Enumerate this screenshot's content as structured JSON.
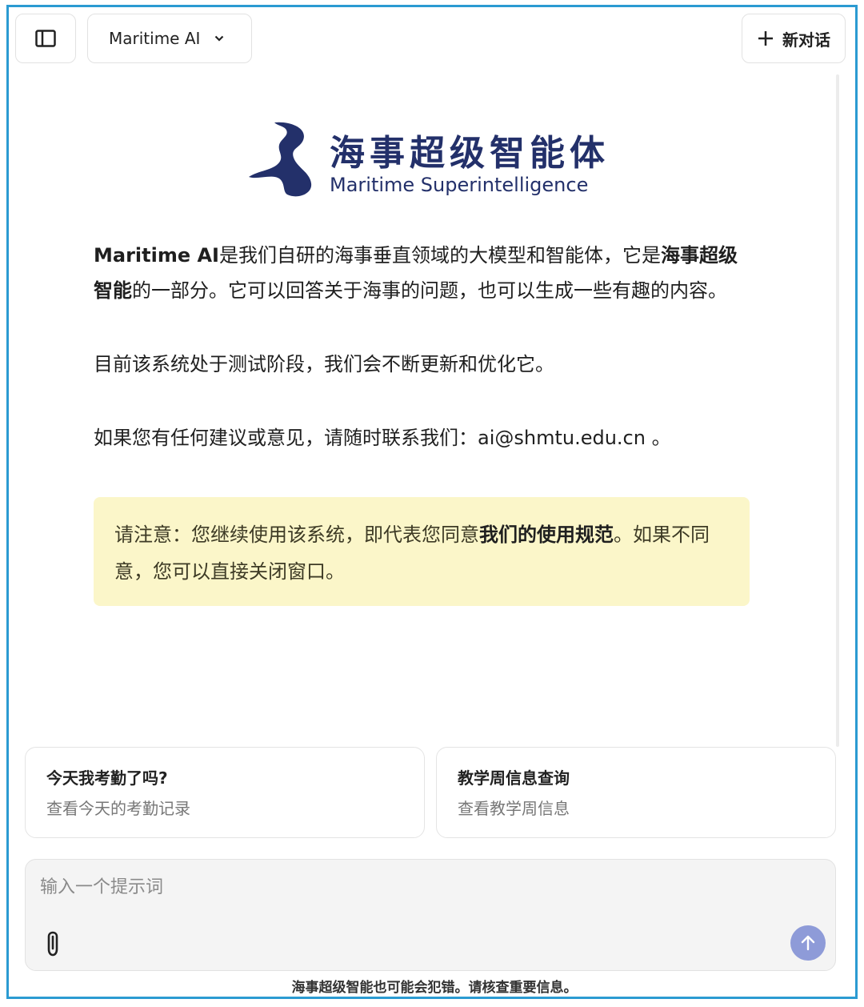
{
  "header": {
    "model_name": "Maritime AI",
    "new_chat_label": "新对话"
  },
  "logo": {
    "title_cn": "海事超级智能体",
    "title_en": "Maritime Superintelligence"
  },
  "intro": {
    "p1_b1": "Maritime AI",
    "p1_t1": "是我们自研的海事垂直领域的大模型和智能体，它是",
    "p1_b2": "海事超级智能",
    "p1_t2": "的一部分。它可以回答关于海事的问题，也可以生成一些有趣的内容。",
    "p2": "目前该系统处于测试阶段，我们会不断更新和优化它。",
    "p3_text": "如果您有任何建议或意见，请随时联系我们：",
    "p3_email": "ai@shmtu.edu.cn",
    "p3_end": " 。"
  },
  "notice": {
    "t1": "请注意：您继续使用该系统，即代表您同意",
    "b1": "我们的使用规范",
    "t2": "。如果不同意，您可以直接关闭窗口。"
  },
  "suggestions": [
    {
      "title": "今天我考勤了吗?",
      "subtitle": "查看今天的考勤记录"
    },
    {
      "title": "教学周信息查询",
      "subtitle": "查看教学周信息"
    }
  ],
  "input": {
    "placeholder": "输入一个提示词"
  },
  "footer": {
    "disclaimer": "海事超级智能也可能会犯错。请核查重要信息。"
  },
  "colors": {
    "frame": "#2b9bd2",
    "brand": "#23306a",
    "notice_bg": "#fbf6c9",
    "send_button": "#8e9bd8"
  },
  "icons": {
    "sidebar_toggle": "sidebar-panel-icon",
    "model_dropdown": "chevron-down-icon",
    "new_chat": "plus-icon",
    "attach": "paperclip-icon",
    "send": "arrow-up-icon"
  }
}
